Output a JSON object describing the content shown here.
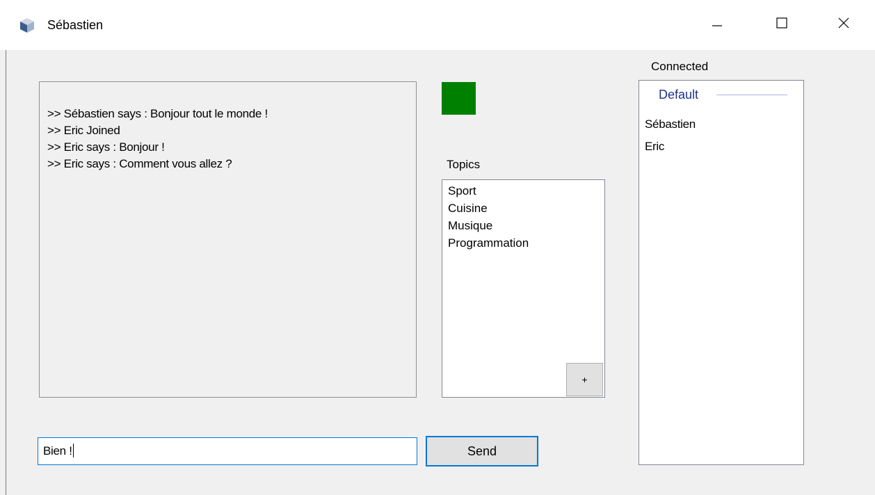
{
  "window": {
    "title": "Sébastien",
    "icon": "cube-icon",
    "controls": [
      "minimize-icon",
      "maximize-icon",
      "close-icon"
    ]
  },
  "chat": {
    "messages": [
      ">> Sébastien says : Bonjour tout le monde !",
      ">> Eric Joined",
      ">> Eric says : Bonjour !",
      ">> Eric says : Comment vous allez ?"
    ]
  },
  "status": {
    "color": "#008000"
  },
  "topics": {
    "label": "Topics",
    "items": [
      "Sport",
      "Cuisine",
      "Musique",
      "Programmation"
    ],
    "add_label": "+"
  },
  "connected": {
    "label": "Connected",
    "group": "Default",
    "users": [
      "Sébastien",
      "Eric"
    ]
  },
  "composer": {
    "value": "Bien !",
    "send_label": "Send"
  },
  "colors": {
    "accent": "#0078d7",
    "group_header": "#1e3287",
    "status_online": "#008000"
  }
}
